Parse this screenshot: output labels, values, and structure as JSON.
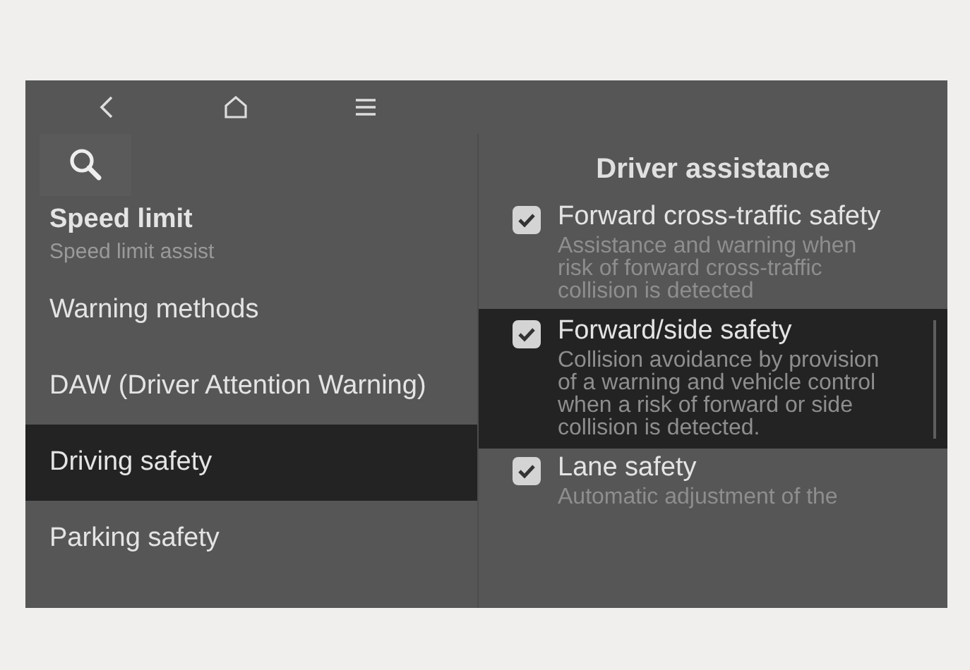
{
  "nav": {
    "buttons": [
      {
        "kind": "back"
      },
      {
        "kind": "home"
      },
      {
        "kind": "menu"
      }
    ]
  },
  "menu": {
    "items": [
      {
        "label": "Speed limit",
        "sublabel": "Speed limit assist",
        "selected": false
      },
      {
        "label": "Warning methods",
        "selected": false
      },
      {
        "label": "DAW (Driver Attention Warning)",
        "selected": false
      },
      {
        "label": "Driving safety",
        "selected": true
      },
      {
        "label": "Parking safety",
        "selected": false
      }
    ]
  },
  "panel": {
    "title": "Driver assistance",
    "options": [
      {
        "label": "Forward cross-traffic safety",
        "description": "Assistance and warning when risk of forward cross-traffic collision is detected",
        "checked": true,
        "selected": false
      },
      {
        "label": "Forward/side safety",
        "description": "Collision avoidance by provision of a warning and vehicle control when a risk of forward or side collision is detected.",
        "checked": true,
        "selected": true
      },
      {
        "label": "Lane safety",
        "description": "Automatic adjustment of the",
        "checked": true,
        "selected": false
      }
    ]
  }
}
